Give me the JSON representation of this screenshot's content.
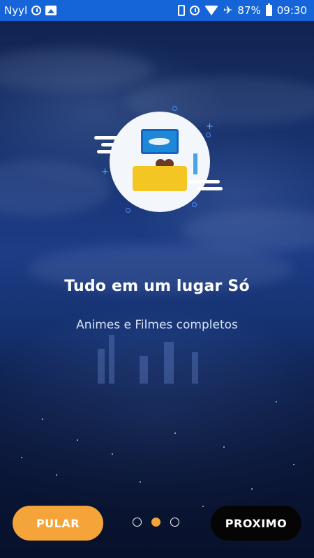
{
  "status_bar": {
    "carrier": "Nyyl",
    "battery": "87%",
    "time": "09:30",
    "background": "#1565d8"
  },
  "onboarding": {
    "title": "Tudo em um lugar Só",
    "subtitle": "Animes e Filmes completos",
    "page_count": 3,
    "active_page": 2
  },
  "actions": {
    "skip_label": "PULAR",
    "next_label": "PROXIMO"
  },
  "colors": {
    "accent": "#f5a43a",
    "next_button": "#050505",
    "illustration_circle": "#f3f6fb",
    "sofa": "#f3c623",
    "tv": "#1e88d8"
  },
  "icons": [
    "alarm-icon",
    "image-icon",
    "vibrate-icon",
    "wifi-icon",
    "airplane-icon",
    "battery-icon"
  ]
}
